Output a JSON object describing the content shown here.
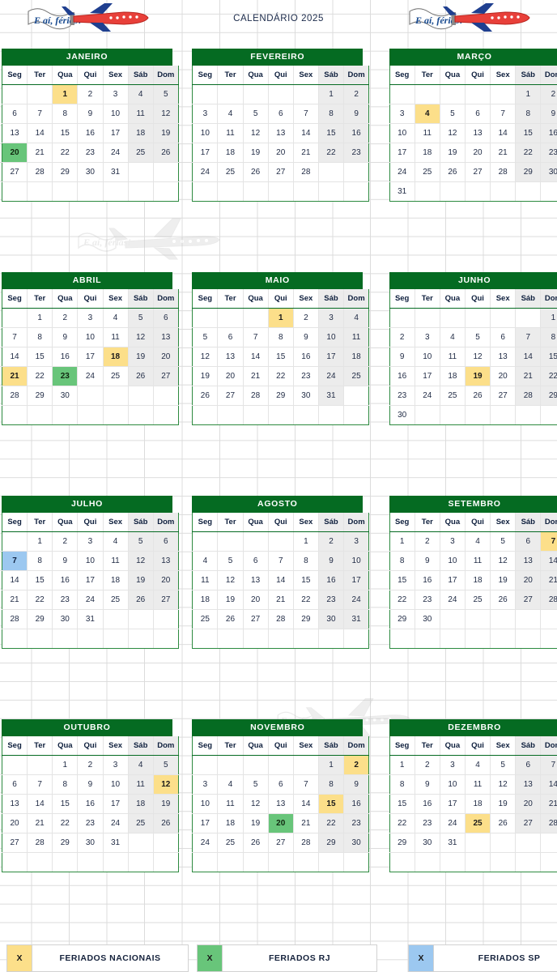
{
  "header": {
    "title": "CALENDÁRIO 2025",
    "logo_text": "E aí, férias!"
  },
  "weekdays": [
    "Seg",
    "Ter",
    "Qua",
    "Qui",
    "Sex",
    "Sáb",
    "Dom"
  ],
  "colors": {
    "month_header": "#056b22",
    "holiday_national": "#fcdf8a",
    "holiday_rj": "#68c57a",
    "holiday_sp": "#9cc8f0",
    "weekend_cell": "#ececec",
    "grid_border": "#2c8a3f"
  },
  "legend": [
    {
      "swatch_label": "X",
      "label": "FERIADOS NACIONAIS",
      "type": "nac"
    },
    {
      "swatch_label": "X",
      "label": "FERIADOS RJ",
      "type": "rj"
    },
    {
      "swatch_label": "X",
      "label": "FERIADOS SP",
      "type": "sp"
    }
  ],
  "months": [
    {
      "name": "JANEIRO",
      "lead_blanks": 2,
      "days": 31,
      "holidays_national": [
        1
      ],
      "holidays_rj": [
        20
      ],
      "holidays_sp": []
    },
    {
      "name": "FEVEREIRO",
      "lead_blanks": 5,
      "days": 28,
      "holidays_national": [],
      "holidays_rj": [],
      "holidays_sp": []
    },
    {
      "name": "MARÇO",
      "lead_blanks": 5,
      "days": 31,
      "holidays_national": [
        4
      ],
      "holidays_rj": [],
      "holidays_sp": []
    },
    {
      "name": "ABRIL",
      "lead_blanks": 1,
      "days": 30,
      "holidays_national": [
        18,
        21
      ],
      "holidays_rj": [
        23
      ],
      "holidays_sp": []
    },
    {
      "name": "MAIO",
      "lead_blanks": 3,
      "days": 31,
      "holidays_national": [
        1
      ],
      "holidays_rj": [],
      "holidays_sp": []
    },
    {
      "name": "JUNHO",
      "lead_blanks": 6,
      "days": 30,
      "holidays_national": [
        19
      ],
      "holidays_rj": [],
      "holidays_sp": []
    },
    {
      "name": "JULHO",
      "lead_blanks": 1,
      "days": 31,
      "holidays_national": [],
      "holidays_rj": [],
      "holidays_sp": [
        7
      ]
    },
    {
      "name": "AGOSTO",
      "lead_blanks": 4,
      "days": 31,
      "holidays_national": [],
      "holidays_rj": [],
      "holidays_sp": []
    },
    {
      "name": "SETEMBRO",
      "lead_blanks": 0,
      "days": 30,
      "holidays_national": [
        7
      ],
      "holidays_rj": [],
      "holidays_sp": []
    },
    {
      "name": "OUTUBRO",
      "lead_blanks": 2,
      "days": 31,
      "holidays_national": [
        12
      ],
      "holidays_rj": [],
      "holidays_sp": []
    },
    {
      "name": "NOVEMBRO",
      "lead_blanks": 5,
      "days": 30,
      "holidays_national": [
        2,
        15
      ],
      "holidays_rj": [
        20
      ],
      "holidays_sp": []
    },
    {
      "name": "DEZEMBRO",
      "lead_blanks": 0,
      "days": 31,
      "holidays_national": [
        25
      ],
      "holidays_rj": [],
      "holidays_sp": []
    }
  ]
}
